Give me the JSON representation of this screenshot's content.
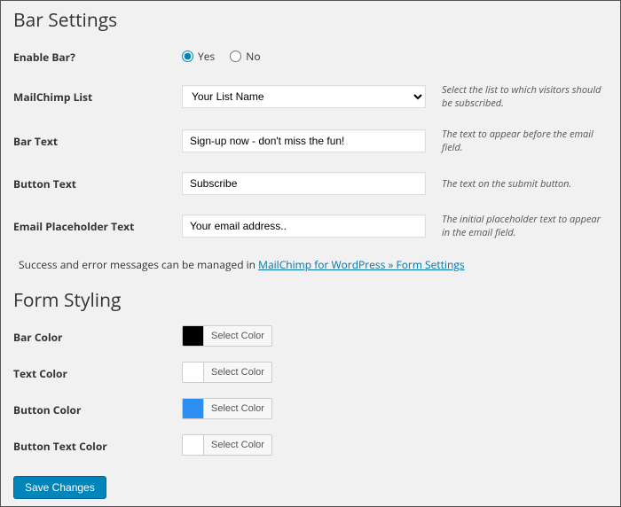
{
  "sections": {
    "bar_settings_title": "Bar Settings",
    "form_styling_title": "Form Styling"
  },
  "fields": {
    "enable_bar": {
      "label": "Enable Bar?",
      "yes": "Yes",
      "no": "No",
      "value": "yes"
    },
    "mailchimp_list": {
      "label": "MailChimp List",
      "selected": "Your List Name",
      "hint": "Select the list to which visitors should be subscribed."
    },
    "bar_text": {
      "label": "Bar Text",
      "value": "Sign-up now - don't miss the fun!",
      "hint": "The text to appear before the email field."
    },
    "button_text": {
      "label": "Button Text",
      "value": "Subscribe",
      "hint": "The text on the submit button."
    },
    "email_placeholder": {
      "label": "Email Placeholder Text",
      "value": "Your email address..",
      "hint": "The initial placeholder text to appear in the email field."
    }
  },
  "info": {
    "prefix": "Success and error messages can be managed in ",
    "link": "MailChimp for WordPress » Form Settings"
  },
  "styling": {
    "select_color_label": "Select Color",
    "bar_color": {
      "label": "Bar Color",
      "value": "#000000"
    },
    "text_color": {
      "label": "Text Color",
      "value": "#ffffff"
    },
    "button_color": {
      "label": "Button Color",
      "value": "#2b8ef0"
    },
    "button_text_color": {
      "label": "Button Text Color",
      "value": "#ffffff"
    }
  },
  "actions": {
    "save": "Save Changes"
  }
}
